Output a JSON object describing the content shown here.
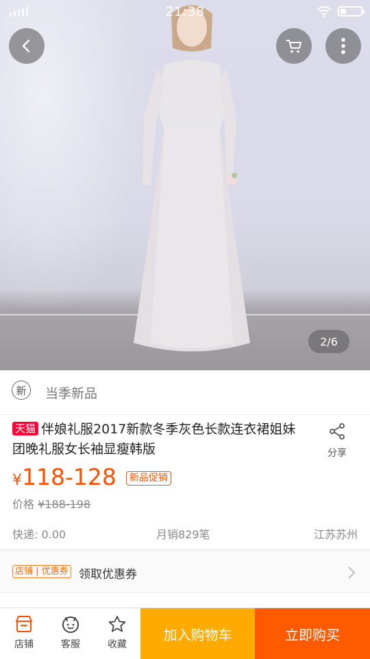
{
  "status_bar": {
    "time": "21:38"
  },
  "gallery": {
    "page_indicator": "2/6"
  },
  "season": {
    "icon_char": "新",
    "label": "当季新品"
  },
  "product": {
    "store_badge": "天猫",
    "title": "伴娘礼服2017新款冬季灰色长款连衣裙姐妹团晚礼服女长袖显瘦韩版",
    "share_label": "分享",
    "price_symbol": "¥",
    "price": "118-128",
    "promo_tag": "新品促销",
    "original_price_label": "价格",
    "original_price": "¥188-198",
    "shipping": "快递: 0.00",
    "monthly_sales": "月销829笔",
    "location": "江苏苏州"
  },
  "coupon": {
    "tag": "店铺 | 优惠券",
    "label": "领取优惠券"
  },
  "bottom_bar": {
    "tabs": [
      {
        "label": "店铺",
        "icon": "shop-icon"
      },
      {
        "label": "客服",
        "icon": "customer-service-icon"
      },
      {
        "label": "收藏",
        "icon": "star-icon"
      }
    ],
    "add_to_cart": "加入购物车",
    "buy_now": "立即购买"
  },
  "colors": {
    "accent": "#ff5000",
    "tmall_red": "#ff0036",
    "cart_btn": "#ffaa00",
    "buy_btn": "#ff5a00"
  }
}
